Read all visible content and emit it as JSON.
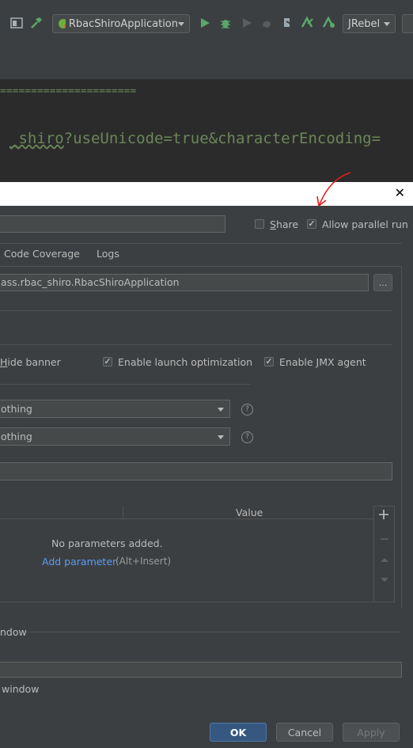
{
  "toolbar": {
    "run_config": "RbacShiroApplication",
    "jrebel": "JRebel",
    "icons": [
      "window-icon",
      "build-hammer-icon",
      "run-icon",
      "debug-icon",
      "run-coverage-icon",
      "profile-icon",
      "attach-icon",
      "jrebel-run-icon",
      "jrebel-debug-icon"
    ]
  },
  "editor": {
    "line1": "======================",
    "line2_squiggle": "_shiro",
    "line2_rest": "?useUnicode=true&characterEncoding="
  },
  "dialog": {
    "close": "✕",
    "share": "Share",
    "allow_parallel": "Allow parallel run",
    "tabs": [
      "Code Coverage",
      "Logs"
    ],
    "main_class": "ass.rbac_shiro.RbacShiroApplication",
    "browse": "...",
    "hide_banner": "Hide banner",
    "enable_launch": "Enable launch optimization",
    "enable_jmx": "Enable JMX agent",
    "select1": "othing",
    "select2": "othing",
    "table": {
      "col_value": "Value",
      "empty": "No parameters added.",
      "add_link": "Add parameter",
      "add_hint": "(Alt+Insert)"
    },
    "section_window": "ndow",
    "window_label": "window",
    "ok": "OK",
    "cancel": "Cancel",
    "apply": "Apply"
  },
  "colors": {
    "link": "#589df6",
    "ok_button": "#365880",
    "annotation": "#e02020"
  }
}
